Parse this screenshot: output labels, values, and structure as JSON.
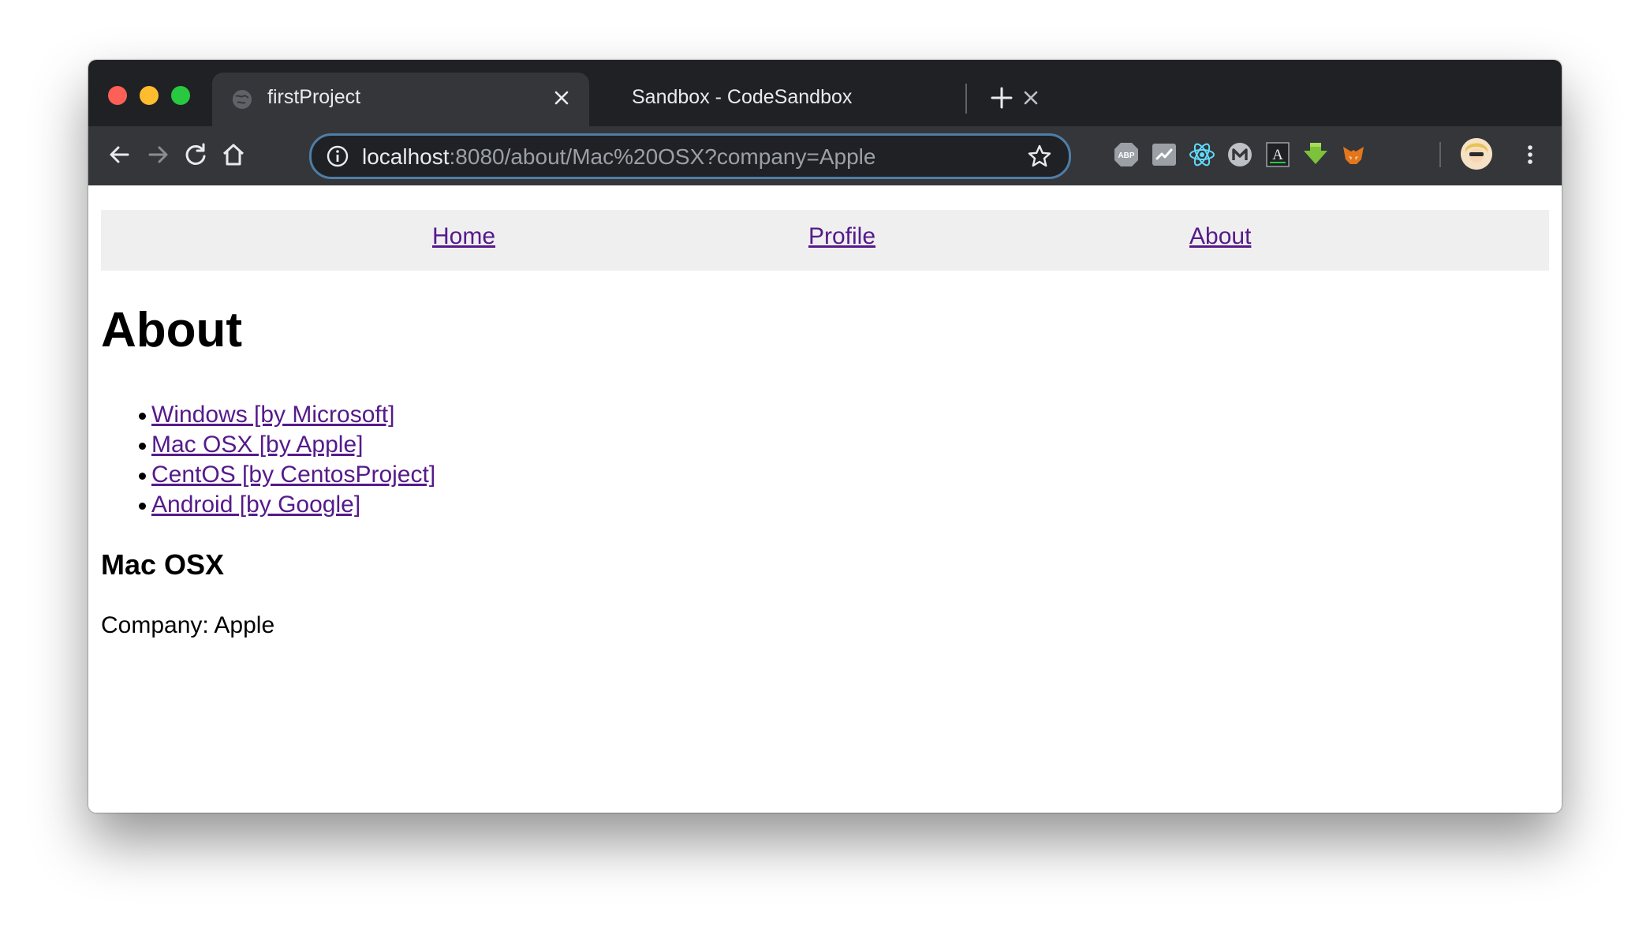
{
  "browser": {
    "tabs": [
      {
        "title": "firstProject",
        "active": true
      },
      {
        "title": "Sandbox - CodeSandbox",
        "active": false
      }
    ],
    "address_bar": {
      "host": "localhost",
      "path": ":8080/about/Mac%20OSX?company=Apple"
    },
    "extensions": [
      "adblock-icon",
      "trend-icon",
      "react-devtools-icon",
      "m-icon",
      "font-icon",
      "download-icon",
      "metamask-icon"
    ],
    "icons": {
      "back": "back-arrow-icon",
      "forward": "forward-arrow-icon",
      "reload": "reload-icon",
      "home": "home-icon",
      "info": "info-icon",
      "bookmark": "star-icon",
      "menu": "kebab-menu-icon"
    },
    "colors": {
      "tabstrip": "#202124",
      "toolbar": "#35363a",
      "omnibox_border": "#4d7ea8"
    }
  },
  "page": {
    "nav": [
      {
        "label": "Home"
      },
      {
        "label": "Profile"
      },
      {
        "label": "About"
      }
    ],
    "heading": "About",
    "os_list": [
      {
        "label": "Windows [by Microsoft]"
      },
      {
        "label": "Mac OSX [by Apple]"
      },
      {
        "label": "CentOS [by CentosProject]"
      },
      {
        "label": "Android [by Google]"
      }
    ],
    "selected_os": "Mac OSX",
    "company_label": "Company: Apple",
    "colors": {
      "link_visited": "#551a8b",
      "nav_background": "#efefef"
    }
  }
}
